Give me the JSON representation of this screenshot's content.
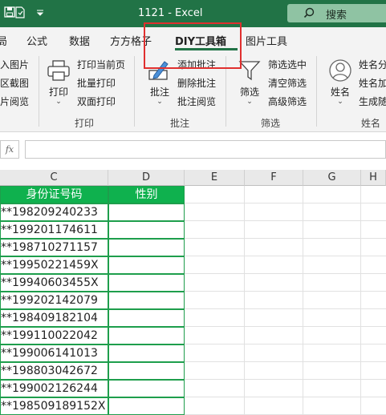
{
  "titlebar": {
    "title": "1121 - Excel",
    "search_label": "搜索",
    "qa_icons": [
      "save-icon",
      "file-icon",
      "qat-dropdown-icon"
    ]
  },
  "tabs": [
    "局",
    "公式",
    "数据",
    "方方格子",
    "DIY工具箱",
    "图片工具"
  ],
  "active_tab": "DIY工具箱",
  "ribbon": {
    "group1": {
      "items": [
        "入图片",
        "区截图",
        "片阅览"
      ]
    },
    "print_group": {
      "big_button": "打印",
      "items": [
        "打印当前页",
        "批量打印",
        "双面打印"
      ],
      "label": "打印"
    },
    "annotation_group": {
      "big_button": "批注",
      "items": [
        "添加批注",
        "删除批注",
        "批注阅览"
      ],
      "label": "批注"
    },
    "filter_group": {
      "big_button": "筛选",
      "items": [
        "筛选选中",
        "清空筛选",
        "高级筛选"
      ],
      "label": "筛选"
    },
    "name_group": {
      "big_button": "姓名",
      "items": [
        "姓名分",
        "姓名加",
        "生成随"
      ],
      "label": "姓名"
    }
  },
  "formula_bar": {
    "fx": "fx",
    "value": ""
  },
  "columns": [
    "C",
    "D",
    "E",
    "F",
    "G",
    "H"
  ],
  "header_row": {
    "c": "身份证号码",
    "d": "性别"
  },
  "rows": [
    "**198209240233",
    "**199201174611",
    "**198710271157",
    "**19950221459X",
    "**19940603455X",
    "**199202142079",
    "**198409182104",
    "**199110022042",
    "**199006141013",
    "**198803042672",
    "**199002126244",
    "**198509189152X"
  ],
  "colors": {
    "excel_green": "#217346",
    "header_fill": "#0fb14e",
    "highlight": "#e0302f"
  }
}
